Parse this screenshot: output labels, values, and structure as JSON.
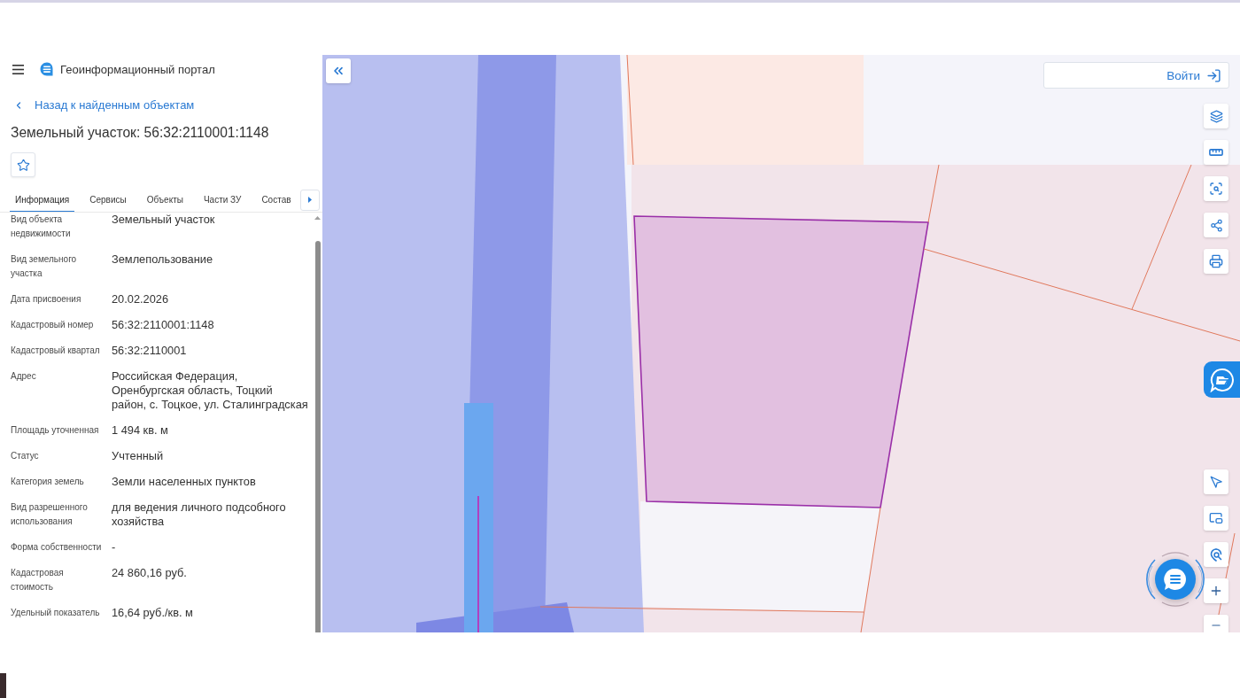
{
  "header": {
    "title": "Геоинформационный портал"
  },
  "back_link": {
    "label": "Назад к найденным объектам"
  },
  "object": {
    "title": "Земельный участок: 56:32:2110001:1148"
  },
  "tabs": [
    {
      "label": "Информация",
      "selected": true
    },
    {
      "label": "Сервисы",
      "selected": false
    },
    {
      "label": "Объекты",
      "selected": false
    },
    {
      "label": "Части ЗУ",
      "selected": false
    },
    {
      "label": "Состав",
      "selected": false
    }
  ],
  "info_rows": [
    {
      "label": "Вид объекта недвижимости",
      "value": "Земельный участок"
    },
    {
      "label": "Вид земельного участка",
      "value": "Землепользование"
    },
    {
      "label": "Дата присвоения",
      "value": "20.02.2026"
    },
    {
      "label": "Кадастровый номер",
      "value": "56:32:2110001:1148"
    },
    {
      "label": "Кадастровый квартал",
      "value": "56:32:2110001"
    },
    {
      "label": "Адрес",
      "value": "Российская Федерация, Оренбургская область, Тоцкий район, с. Тоцкое, ул. Сталинградская"
    },
    {
      "label": "Площадь уточненная",
      "value": "1 494 кв. м"
    },
    {
      "label": "Статус",
      "value": "Учтенный"
    },
    {
      "label": "Категория земель",
      "value": "Земли населенных пунктов"
    },
    {
      "label": "Вид разрешенного использования",
      "value": "для ведения личного подсобного хозяйства"
    },
    {
      "label": "Форма собственности",
      "value": "-"
    },
    {
      "label": "Кадастровая стоимость",
      "value": "24 860,16 руб."
    },
    {
      "label": "Удельный показатель",
      "value": "16,64 руб./кв. м"
    }
  ],
  "map": {
    "login_button": {
      "label": "Войти"
    }
  }
}
